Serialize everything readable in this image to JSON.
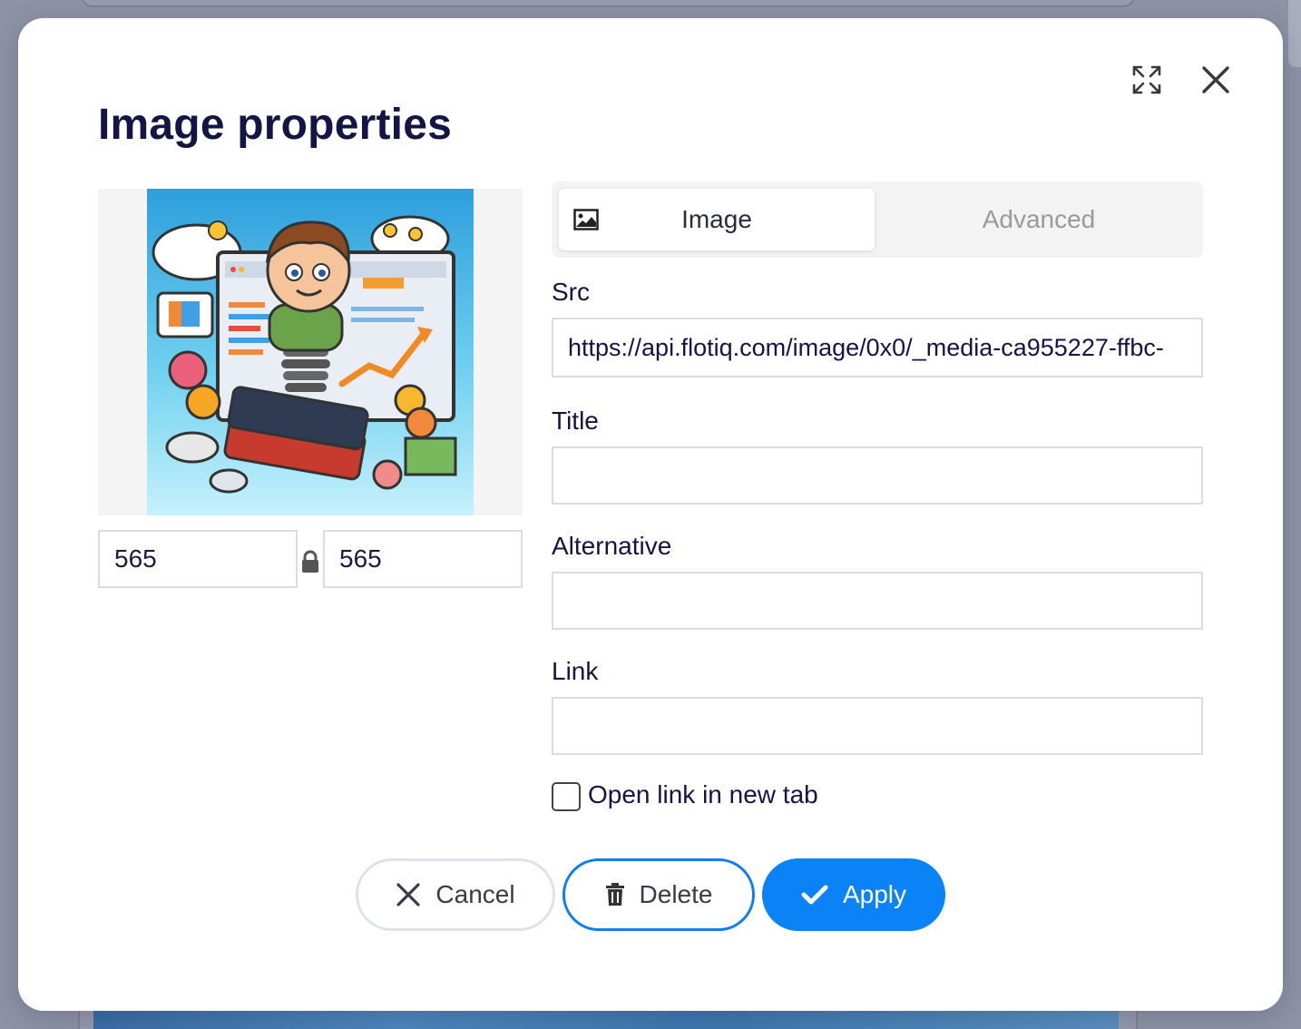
{
  "modal": {
    "title": "Image properties",
    "expand_icon": "expand-icon",
    "close_icon": "close-icon"
  },
  "preview": {
    "image_description_icon": "illustration-thumbnail",
    "width_value": "565",
    "height_value": "565",
    "lock_icon": "lock-icon"
  },
  "tabs": [
    {
      "label": "Image",
      "icon": "image-icon",
      "active": true
    },
    {
      "label": "Advanced",
      "active": false
    }
  ],
  "fields": {
    "src": {
      "label": "Src",
      "value": "https://api.flotiq.com/image/0x0/_media-ca955227-ffbc-"
    },
    "title": {
      "label": "Title",
      "value": ""
    },
    "alternative": {
      "label": "Alternative",
      "value": ""
    },
    "link": {
      "label": "Link",
      "value": ""
    }
  },
  "checkbox": {
    "label": "Open link in new tab",
    "checked": false
  },
  "buttons": {
    "cancel": {
      "label": "Cancel",
      "icon": "close-icon"
    },
    "delete": {
      "label": "Delete",
      "icon": "trash-icon"
    },
    "apply": {
      "label": "Apply",
      "icon": "check-icon"
    }
  },
  "colors": {
    "title": "#141446",
    "primary": "#0b82f5",
    "overlay": "#8d92a6"
  }
}
